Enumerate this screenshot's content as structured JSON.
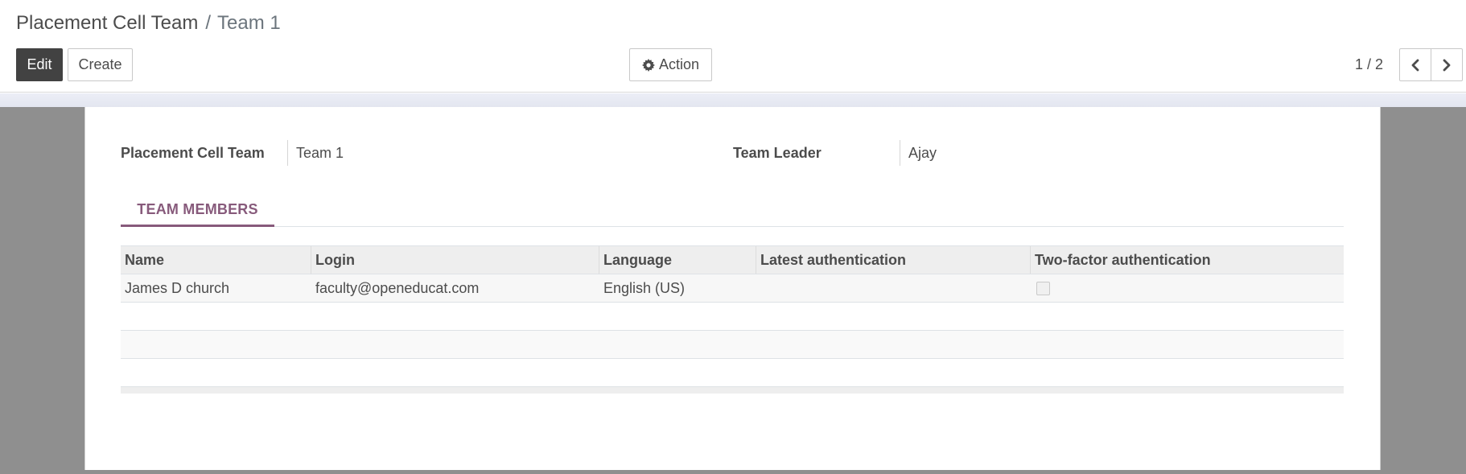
{
  "breadcrumb": {
    "root": "Placement Cell Team",
    "separator": "/",
    "current": "Team 1"
  },
  "toolbar": {
    "edit_label": "Edit",
    "create_label": "Create",
    "action_label": "Action",
    "action_icon": "gear-icon"
  },
  "pager": {
    "value": "1 / 2",
    "prev_icon": "chevron-left-icon",
    "next_icon": "chevron-right-icon"
  },
  "form": {
    "team_label": "Placement Cell Team",
    "team_value": "Team 1",
    "leader_label": "Team Leader",
    "leader_value": "Ajay"
  },
  "tabs": [
    {
      "label": "TEAM MEMBERS",
      "active": true
    }
  ],
  "members_table": {
    "columns": [
      "Name",
      "Login",
      "Language",
      "Latest authentication",
      "Two-factor authentication"
    ],
    "rows": [
      {
        "name": "James D church",
        "login": "faculty@openeducat.com",
        "language": "English (US)",
        "latest_authentication": "",
        "two_factor_enabled": false
      }
    ]
  },
  "colors": {
    "accent": "#875a7b",
    "primary_button": "#424242",
    "backdrop": "#8f8f8f"
  }
}
